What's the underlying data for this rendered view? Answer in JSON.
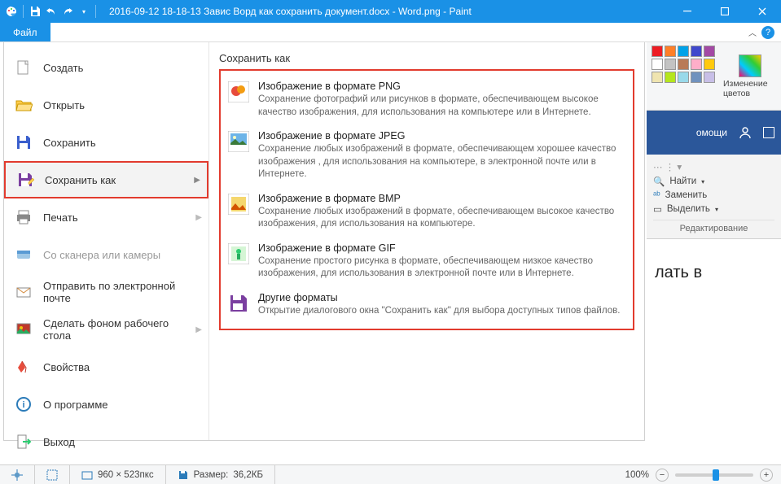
{
  "titlebar": {
    "title": "2016-09-12 18-18-13 Завис Ворд как сохранить документ.docx - Word.png - Paint"
  },
  "filetab": {
    "label": "Файл"
  },
  "menu": {
    "create": "Создать",
    "open": "Открыть",
    "save": "Сохранить",
    "saveas": "Сохранить как",
    "print": "Печать",
    "scanner": "Со сканера или камеры",
    "email": "Отправить по электронной почте",
    "desktopbg": "Сделать фоном рабочего стола",
    "properties": "Свойства",
    "about": "О программе",
    "exit": "Выход"
  },
  "submenu": {
    "header": "Сохранить как",
    "png": {
      "title": "Изображение в формате PNG",
      "desc": "Сохранение фотографий или рисунков в формате, обеспечивающем высокое качество изображения, для использования на компьютере или в Интернете."
    },
    "jpeg": {
      "title": "Изображение в формате JPEG",
      "desc": "Сохранение любых изображений в формате, обеспечивающем хорошее качество изображения , для использования на компьютере, в электронной почте или в Интернете."
    },
    "bmp": {
      "title": "Изображение в формате BMP",
      "desc": "Сохранение любых изображений в формате, обеспечивающем высокое качество изображения, для использования на компьютере."
    },
    "gif": {
      "title": "Изображение в формате GIF",
      "desc": "Сохранение простого рисунка в формате, обеспечивающем низкое качество изображения, для использования в электронной почте или в Интернете."
    },
    "other": {
      "title": "Другие форматы",
      "desc": "Открытие диалогового окна \"Сохранить как\" для выбора доступных типов файлов."
    }
  },
  "palette": {
    "label": "Изменение цветов",
    "colors": [
      "#ed1c24",
      "#ff7f27",
      "#00a2e8",
      "#3f48cc",
      "#a349a4",
      "#ffffff",
      "#c3c3c3",
      "#b97a57",
      "#ffaec9",
      "#ffc90e",
      "#efe4b0",
      "#b5e61d",
      "#99d9ea",
      "#7092be",
      "#c8bfe7"
    ]
  },
  "word": {
    "help": "омощи",
    "find": "Найти",
    "replace": "Заменить",
    "select": "Выделить",
    "editing": "Редактирование",
    "doc_text": "лать в"
  },
  "status": {
    "dims": "960 × 523пкс",
    "size_label": "Размер:",
    "size_value": "36,2КБ",
    "zoom": "100%"
  }
}
